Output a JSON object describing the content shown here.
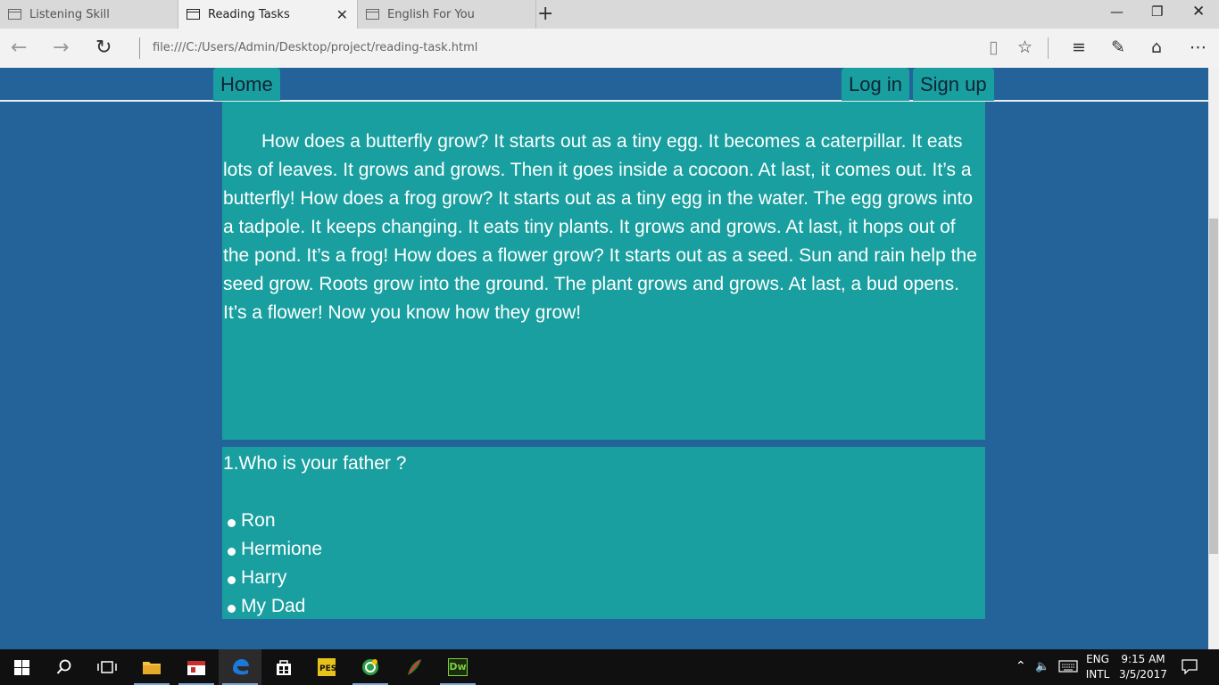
{
  "browser": {
    "tabs": [
      {
        "label": "Listening Skill",
        "active": false
      },
      {
        "label": "Reading Tasks",
        "active": true
      },
      {
        "label": "English For You",
        "active": false
      }
    ],
    "url": "file:///C:/Users/Admin/Desktop/project/reading-task.html"
  },
  "nav": {
    "home": "Home",
    "login": "Log in",
    "signup": "Sign up"
  },
  "reading": {
    "text": "How does a butterfly grow? It starts out as a tiny egg. It becomes a caterpillar. It eats lots of leaves. It grows and grows. Then it goes inside a cocoon. At last, it comes out. It’s a butterfly! How does a frog grow? It starts out as a tiny egg in the water. The egg grows into a tadpole. It keeps changing. It eats tiny plants. It grows and grows. At last, it hops out of the pond. It’s a frog! How does a flower grow? It starts out as a seed. Sun and rain help the seed grow. Roots grow into the ground. The plant grows and grows. At last, a bud opens. It’s a flower! Now you know how they grow!"
  },
  "quiz": {
    "question": "1.Who is your father ?",
    "options": [
      "Ron",
      "Hermione",
      "Harry",
      "My Dad"
    ]
  },
  "taskbar": {
    "language": "ENG",
    "layout": "INTL",
    "time": "9:15 AM",
    "date": "3/5/2017",
    "dreamweaver_label": "Dw"
  },
  "colors": {
    "page_background": "#236399",
    "panel": "#199f9f",
    "nav_text": "#0f2437"
  }
}
